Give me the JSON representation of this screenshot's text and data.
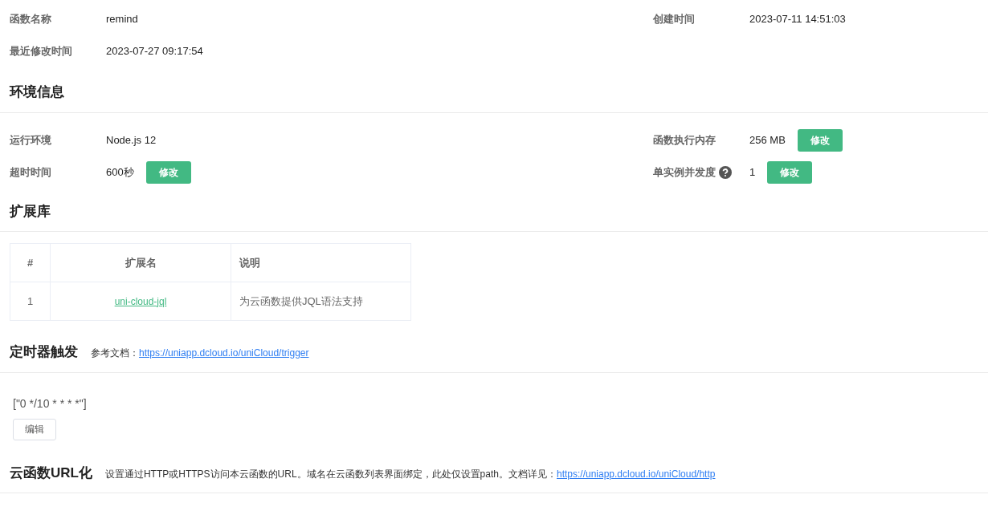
{
  "basic_info": {
    "rows": [
      [
        {
          "label": "函数名称",
          "value": "remind"
        },
        {
          "label": "创建时间",
          "value": "2023-07-11 14:51:03"
        }
      ],
      [
        {
          "label": "最近修改时间",
          "value": "2023-07-27 09:17:54"
        }
      ]
    ]
  },
  "environment": {
    "title": "环境信息",
    "rows": [
      [
        {
          "label": "运行环境",
          "value": "Node.js 12"
        },
        {
          "label": "函数执行内存",
          "value": "256 MB",
          "button": "修改"
        }
      ],
      [
        {
          "label": "超时时间",
          "value": "600秒",
          "button": "修改"
        },
        {
          "label": "单实例并发度",
          "help": true,
          "value": "1",
          "button": "修改"
        }
      ]
    ]
  },
  "extensions": {
    "title": "扩展库",
    "table": {
      "columns": [
        "#",
        "扩展名",
        "说明"
      ],
      "rows": [
        [
          "1",
          "uni-cloud-jql",
          "为云函数提供JQL语法支持"
        ]
      ]
    }
  },
  "timer": {
    "title": "定时器触发",
    "doc_label": "参考文档：",
    "doc_link": "https://uniapp.dcloud.io/uniCloud/trigger",
    "cron": "[\"0 */10 * * * *\"]",
    "button": "编辑"
  },
  "url": {
    "title": "云函数URL化",
    "description": "设置通过HTTP或HTTPS访问本云函数的URL。域名在云函数列表界面绑定，此处仅设置path。文档详见：",
    "link": "https://uniapp.dcloud.io/uniCloud/http"
  }
}
